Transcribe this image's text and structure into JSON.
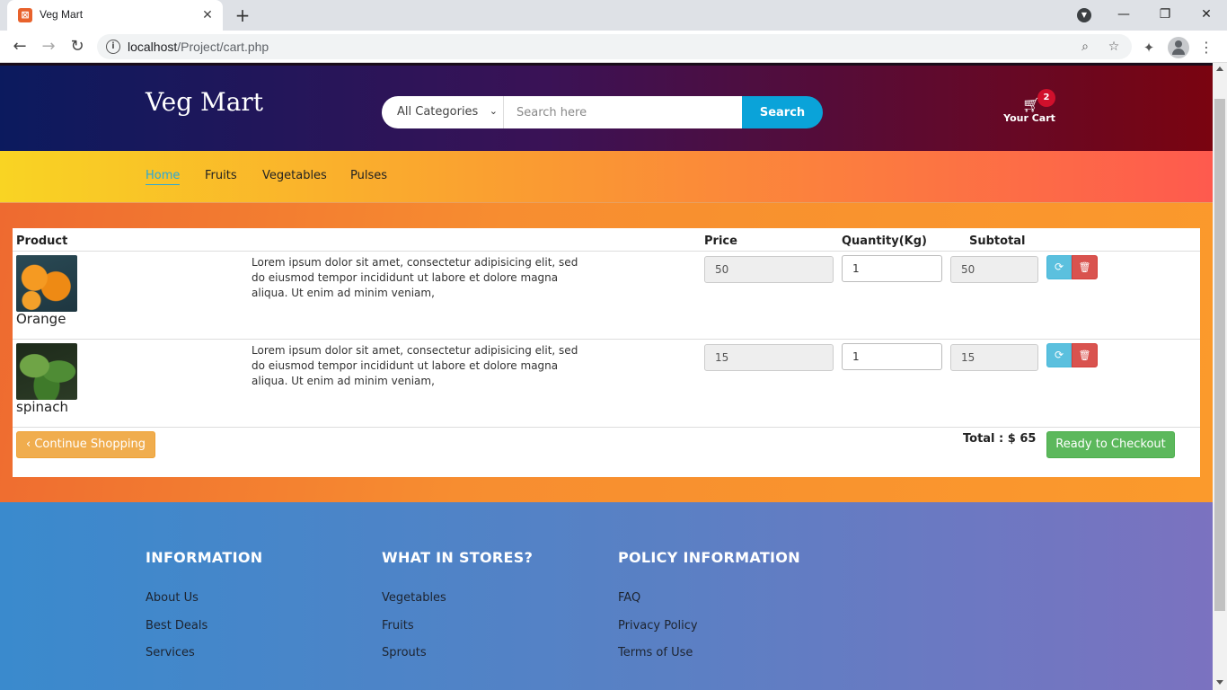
{
  "browser": {
    "tab_title": "Veg Mart",
    "tab_favicon": "xampp-icon",
    "url_host": "localhost",
    "url_path": "/Project/cart.php",
    "new_tab_glyph": "+",
    "minimize_glyph": "—",
    "restore_glyph": "❐",
    "close_glyph": "✕"
  },
  "header": {
    "logo": "Veg Mart",
    "category_selected": "All Categories",
    "search_placeholder": "Search here",
    "search_button": "Search",
    "cart_count": "2",
    "cart_label": "Your Cart"
  },
  "nav": {
    "items": [
      {
        "label": "Home",
        "active": true
      },
      {
        "label": "Fruits"
      },
      {
        "label": "Vegetables"
      },
      {
        "label": "Pulses"
      }
    ]
  },
  "cart": {
    "headers": {
      "product": "Product",
      "price": "Price",
      "quantity": "Quantity(Kg)",
      "subtotal": "Subtotal"
    },
    "items": [
      {
        "name": "Orange",
        "description": "Lorem ipsum dolor sit amet, consectetur adipisicing elit, sed do eiusmod tempor incididunt ut labore et dolore magna aliqua. Ut enim ad minim veniam,",
        "price": "50",
        "quantity": "1",
        "subtotal": "50"
      },
      {
        "name": "spinach",
        "description": "Lorem ipsum dolor sit amet, consectetur adipisicing elit, sed do eiusmod tempor incididunt ut labore et dolore magna aliqua. Ut enim ad minim veniam,",
        "price": "15",
        "quantity": "1",
        "subtotal": "15"
      }
    ],
    "continue_label": "Continue Shopping",
    "total_label": "Total : $ 65",
    "checkout_label": "Ready to Checkout"
  },
  "footer": {
    "columns": [
      {
        "title": "INFORMATION",
        "links": [
          "About Us",
          "Best Deals",
          "Services"
        ]
      },
      {
        "title": "WHAT IN STORES?",
        "links": [
          "Vegetables",
          "Fruits",
          "Sprouts"
        ]
      },
      {
        "title": "POLICY INFORMATION",
        "links": [
          "FAQ",
          "Privacy Policy",
          "Terms of Use"
        ]
      }
    ]
  },
  "colors": {
    "header_start": "#0b1a5e",
    "header_end": "#7a0410",
    "search_button": "#0aa3d9",
    "nav_start": "#f9d423",
    "nav_end": "#fe5a4e",
    "accent_link": "#2aa8d8",
    "checkout": "#5cb85c",
    "continue": "#f0ad4e",
    "delete": "#d9534f",
    "refresh": "#5bc0de",
    "footer_start": "#3a8acd",
    "footer_end": "#7b72c0"
  }
}
